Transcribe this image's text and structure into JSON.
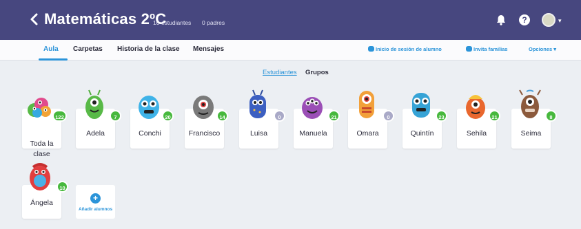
{
  "header": {
    "class_title": "Matemáticas 2ºC",
    "students_count": "10 estudiantes",
    "parents_count": "0 padres",
    "icons": [
      "chevron-left-icon",
      "bell-icon",
      "help-icon",
      "avatar"
    ]
  },
  "tabs": {
    "left": [
      "Aula",
      "Carpetas",
      "Historia de la clase",
      "Mensajes"
    ],
    "active": "Aula",
    "student_login": "Inicio de sesión de alumno",
    "invite_families": "Invita familias",
    "options": "Opciones",
    "options_caret": "▾"
  },
  "view_toggle": {
    "students": "Estudiantes",
    "groups": "Grupos",
    "active": "Estudiantes"
  },
  "students": [
    {
      "name": "Toda la clase",
      "points": "122",
      "badge_color": "green"
    },
    {
      "name": "Adela",
      "points": "7",
      "badge_color": "green"
    },
    {
      "name": "Conchi",
      "points": "20",
      "badge_color": "green"
    },
    {
      "name": "Francisco",
      "points": "14",
      "badge_color": "green"
    },
    {
      "name": "Luisa",
      "points": "0",
      "badge_color": "grey"
    },
    {
      "name": "Manuela",
      "points": "21",
      "badge_color": "green"
    },
    {
      "name": "Omara",
      "points": "0",
      "badge_color": "grey"
    },
    {
      "name": "Quintín",
      "points": "23",
      "badge_color": "green"
    },
    {
      "name": "Sehila",
      "points": "21",
      "badge_color": "green"
    },
    {
      "name": "Seima",
      "points": "8",
      "badge_color": "green"
    },
    {
      "name": "Ángela",
      "points": "10",
      "badge_color": "green"
    }
  ],
  "add_students": {
    "icon": "+",
    "label": "Añadir alumnos"
  },
  "colors": {
    "header_bg": "#47477f",
    "accent_blue": "#2b94d9",
    "points_green": "#47b83d",
    "points_grey": "#a9a9c7",
    "page_bg": "#eceff3"
  }
}
